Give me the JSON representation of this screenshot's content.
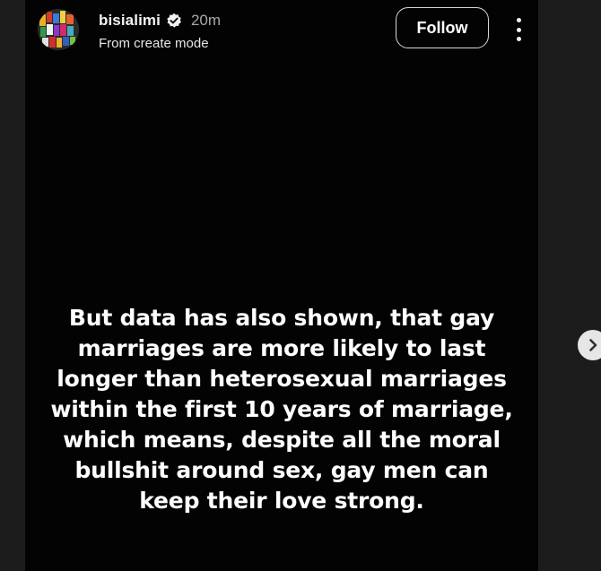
{
  "header": {
    "username": "bisialimi",
    "time_ago": "20m",
    "subtitle": "From create mode",
    "follow_label": "Follow",
    "verified_icon": "verified-badge-icon",
    "more_icon": "more-options-icon"
  },
  "story": {
    "text": "But data has also shown, that gay marriages are more likely to last longer than heterosexual marriages within the first 10 years of marriage, which means, despite all the moral bullshit around sex, gay men can keep their love strong."
  },
  "navigation": {
    "next_icon": "chevron-right-icon"
  },
  "colors": {
    "background": "#1c1c1c",
    "story_background": "#030303",
    "text": "#ffffff",
    "muted_text": "#a8a8a8"
  }
}
